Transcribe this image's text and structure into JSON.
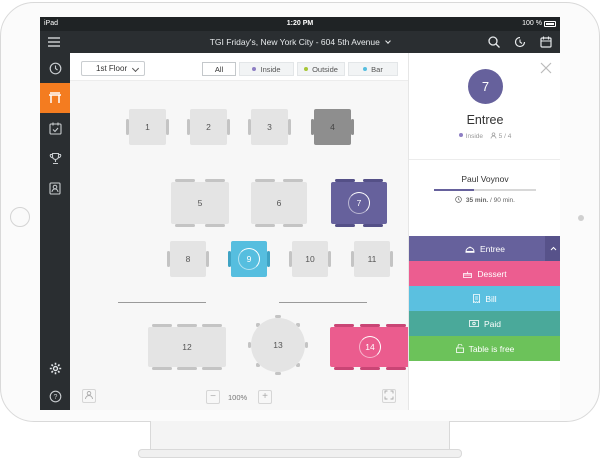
{
  "status_bar": {
    "device": "iPad",
    "time": "1:20 PM",
    "battery": "100 %"
  },
  "navbar": {
    "title": "TGI Friday's, New York City - 604 5th Avenue"
  },
  "toolbar": {
    "floor": "1st Floor",
    "filters": [
      {
        "label": "All",
        "color": ""
      },
      {
        "label": "Inside",
        "color": "#8e7fc4"
      },
      {
        "label": "Outside",
        "color": "#a7c636"
      },
      {
        "label": "Bar",
        "color": "#56bedf"
      }
    ]
  },
  "tables": [
    {
      "label": "1"
    },
    {
      "label": "2"
    },
    {
      "label": "3"
    },
    {
      "label": "4"
    },
    {
      "label": "5"
    },
    {
      "label": "6"
    },
    {
      "label": "7"
    },
    {
      "label": "8"
    },
    {
      "label": "9"
    },
    {
      "label": "10"
    },
    {
      "label": "11"
    },
    {
      "label": "12"
    },
    {
      "label": "13"
    },
    {
      "label": "14"
    }
  ],
  "zoom": {
    "minus": "−",
    "level": "100%",
    "plus": "+"
  },
  "detail": {
    "table_number": "7",
    "status": "Entree",
    "zone": "Inside",
    "guests": "5 / 4",
    "waiter": "Paul Voynov",
    "elapsed": "35 min.",
    "total": "/ 90 min.",
    "progress": 0.39
  },
  "actions": [
    {
      "label": "Entree",
      "color": "#66619c"
    },
    {
      "label": "Dessert",
      "color": "#ec5d90"
    },
    {
      "label": "Bill",
      "color": "#5bc0e0"
    },
    {
      "label": "Paid",
      "color": "#4aa99a"
    },
    {
      "label": "Table is free",
      "color": "#6cc25a"
    }
  ]
}
